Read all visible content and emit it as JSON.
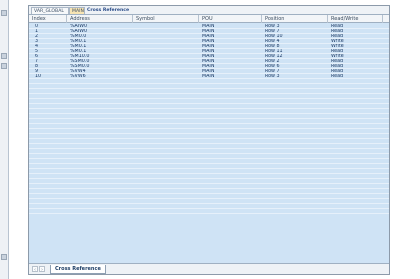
{
  "tabs": [
    {
      "label": "VAR_GLOBAL"
    },
    {
      "label": "MAIN"
    },
    {
      "label": "Cross Reference"
    }
  ],
  "columns": [
    "Index",
    "Address",
    "Symbol",
    "POU",
    "Position",
    "Read/Write"
  ],
  "rows": [
    {
      "index": "0",
      "address": "%AIW0",
      "symbol": "",
      "pou": "MAIN",
      "position": "Row  3",
      "rw": "Read"
    },
    {
      "index": "1",
      "address": "%AIW0",
      "symbol": "",
      "pou": "MAIN",
      "position": "Row  7",
      "rw": "Read"
    },
    {
      "index": "2",
      "address": "%M0.0",
      "symbol": "",
      "pou": "MAIN",
      "position": "Row  10",
      "rw": "Read"
    },
    {
      "index": "3",
      "address": "%M0.1",
      "symbol": "",
      "pou": "MAIN",
      "position": "Row  4",
      "rw": "Write"
    },
    {
      "index": "4",
      "address": "%M0.1",
      "symbol": "",
      "pou": "MAIN",
      "position": "Row  8",
      "rw": "Write"
    },
    {
      "index": "5",
      "address": "%M0.1",
      "symbol": "",
      "pou": "MAIN",
      "position": "Row  11",
      "rw": "Read"
    },
    {
      "index": "6",
      "address": "%M10.0",
      "symbol": "",
      "pou": "MAIN",
      "position": "Row  12",
      "rw": "Write"
    },
    {
      "index": "7",
      "address": "%SM0.0",
      "symbol": "",
      "pou": "MAIN",
      "position": "Row  2",
      "rw": "Read"
    },
    {
      "index": "8",
      "address": "%SM0.0",
      "symbol": "",
      "pou": "MAIN",
      "position": "Row  6",
      "rw": "Read"
    },
    {
      "index": "9",
      "address": "%VW4",
      "symbol": "",
      "pou": "MAIN",
      "position": "Row  7",
      "rw": "Read"
    },
    {
      "index": "10",
      "address": "%VW6",
      "symbol": "",
      "pou": "MAIN",
      "position": "Row  3",
      "rw": "Read"
    }
  ],
  "empty_rows": 27,
  "bottom_tab": {
    "label": "Cross Reference"
  },
  "nav": {
    "prev": "‹",
    "next": "›"
  },
  "colors": {
    "grid_bg": "#cfe3f5",
    "text": "#1c3b66",
    "header_bg": "#f2f5f8"
  }
}
